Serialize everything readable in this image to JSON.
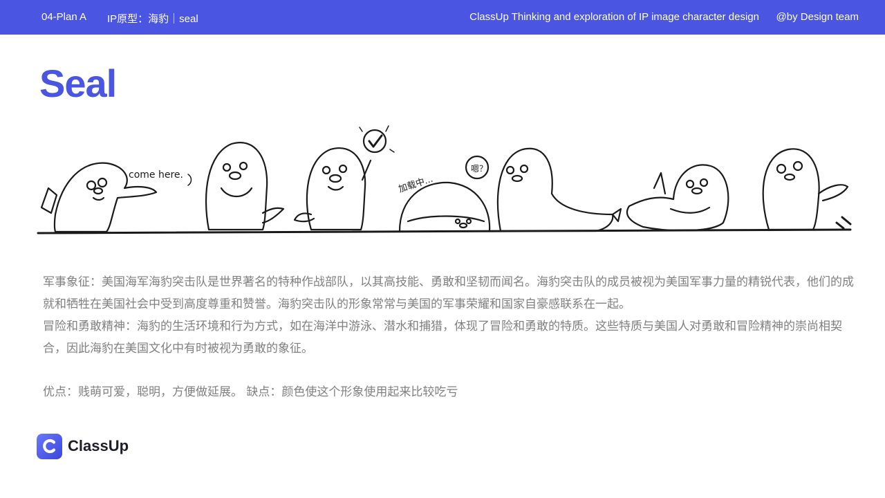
{
  "colors": {
    "accent": "#4a56e2",
    "body_text": "#808080",
    "sketch_ink": "#1a1a1a"
  },
  "header": {
    "plan": "04-Plan  A",
    "ip_prototype": "IP原型：海豹｜seal",
    "subtitle": "ClassUp Thinking and exploration of IP image character design",
    "credit": "@by Design team"
  },
  "title": "Seal",
  "illustration": {
    "caption_come_here": "come here.",
    "caption_loading": "加载中...",
    "caption_speech": "嗯？"
  },
  "body": {
    "paragraph1": "军事象征：美国海军海豹突击队是世界著名的特种作战部队，以其高技能、勇敢和坚韧而闻名。海豹突击队的成员被视为美国军事力量的精锐代表，他们的成就和牺牲在美国社会中受到高度尊重和赞誉。海豹突击队的形象常常与美国的军事荣耀和国家自豪感联系在一起。",
    "paragraph2": "冒险和勇敢精神：海豹的生活环境和行为方式，如在海洋中游泳、潜水和捕猎，体现了冒险和勇敢的特质。这些特质与美国人对勇敢和冒险精神的崇尚相契合，因此海豹在美国文化中有时被视为勇敢的象征。",
    "pros_cons": "优点：贱萌可爱，聪明，方便做延展。 缺点：颜色使这个形象使用起来比较吃亏"
  },
  "footer": {
    "logo_text": "ClassUp",
    "logo_icon": "classup-c-icon"
  }
}
